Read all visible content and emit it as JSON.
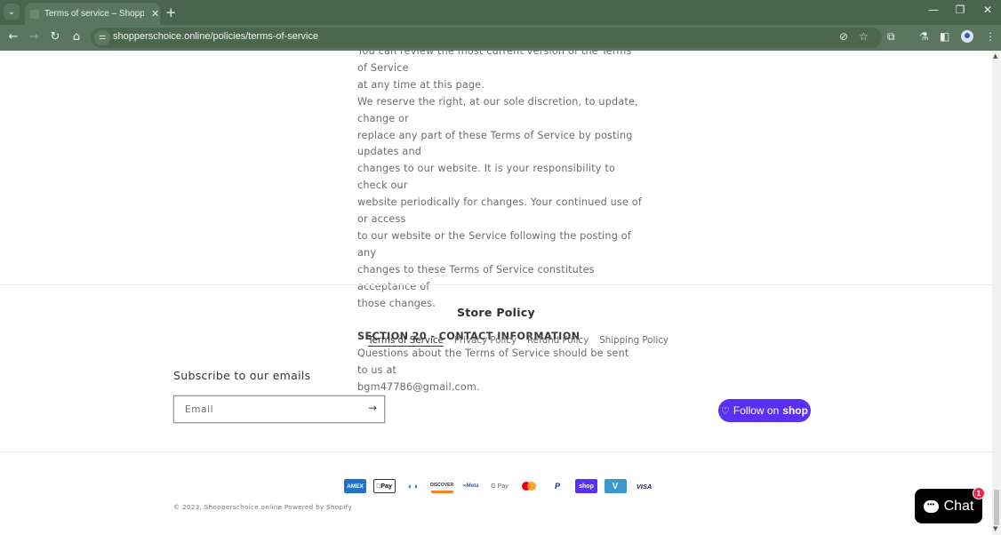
{
  "browser": {
    "tab_title": "Terms of service – Shopperschoice.online",
    "url": "shopperschoice.online/policies/terms-of-service",
    "icons": {
      "tab_list": "chevron-down-icon",
      "tab_close": "close-icon",
      "new_tab": "plus-icon",
      "minimize": "minimize-icon",
      "restore": "restore-icon",
      "close_window": "close-icon",
      "back": "arrow-left-icon",
      "forward": "arrow-right-icon",
      "reload": "reload-icon",
      "home": "home-icon",
      "site_info": "tune-icon",
      "eye_off": "eye-off-icon",
      "bookmark": "star-icon",
      "extensions": "puzzle-icon",
      "labs": "flask-icon",
      "side_panel": "side-panel-icon",
      "profile": "avatar-icon",
      "menu": "kebab-menu-icon"
    },
    "glyphs": {
      "tab_list": "⌄",
      "tab_close": "✕",
      "new_tab": "+",
      "minimize": "—",
      "restore": "❐",
      "close_window": "✕",
      "back": "←",
      "forward": "→",
      "reload": "↻",
      "home": "⌂",
      "site_info": "⚌",
      "eye_off": "⊘",
      "bookmark": "☆",
      "extensions": "⧉",
      "labs": "⚗",
      "side_panel": "◧",
      "menu": "⋮"
    }
  },
  "content": {
    "lines_before": [
      "You can review the most current version of the Terms of Service",
      "at any time at this page."
    ],
    "paragraph_lines": [
      "We reserve the right, at our sole discretion, to update, change or",
      "replace any part of these Terms of Service by posting updates and",
      "changes to our website. It is your responsibility to check our",
      "website periodically for changes. Your continued use of or access",
      "to our website or the Service following the posting of any",
      "changes to these Terms of Service constitutes acceptance of",
      "those changes."
    ],
    "section_heading": "SECTION 20 - CONTACT INFORMATION",
    "contact_lines": [
      "Questions about the Terms of Service should be sent to us at",
      "bgm47786@gmail.com."
    ]
  },
  "footer": {
    "policy_title": "Store Policy",
    "policy_links": [
      {
        "label": "Terms of Service",
        "active": true
      },
      {
        "label": "Privacy Policy",
        "active": false
      },
      {
        "label": "Refund Policy",
        "active": false
      },
      {
        "label": "Shipping Policy",
        "active": false
      }
    ],
    "subscribe_title": "Subscribe to our emails",
    "email_placeholder": "Email",
    "email_value": "",
    "submit_glyph": "→",
    "follow_label": "Follow on",
    "follow_brand": "shop",
    "payment_methods": [
      {
        "name": "American Express",
        "label": "AMEX",
        "cls": "amex"
      },
      {
        "name": "Apple Pay",
        "label": "Pay",
        "cls": "apple"
      },
      {
        "name": "Diners Club",
        "label": "◐◑",
        "cls": "diners"
      },
      {
        "name": "Discover",
        "label": "DISCOVER",
        "cls": "discover"
      },
      {
        "name": "Meta Pay",
        "label": "∞Meta",
        "cls": "meta"
      },
      {
        "name": "Google Pay",
        "label": "G Pay",
        "cls": "gpay"
      },
      {
        "name": "Mastercard",
        "label": "",
        "cls": "master"
      },
      {
        "name": "PayPal",
        "label": "P",
        "cls": "paypal"
      },
      {
        "name": "Shop Pay",
        "label": "shop",
        "cls": "shoppay"
      },
      {
        "name": "Venmo",
        "label": "V",
        "cls": "venmo"
      },
      {
        "name": "Visa",
        "label": "VISA",
        "cls": "visa"
      }
    ],
    "copyright": "© 2023, Shopperschoice.online Powered by Shopify"
  },
  "chat": {
    "label": "Chat",
    "badge_count": "1",
    "bubble_glyph": "•••"
  },
  "colors": {
    "chrome_bg": "#5b765e",
    "shop_purple": "#5a31f4",
    "chat_badge": "#e8284c"
  }
}
